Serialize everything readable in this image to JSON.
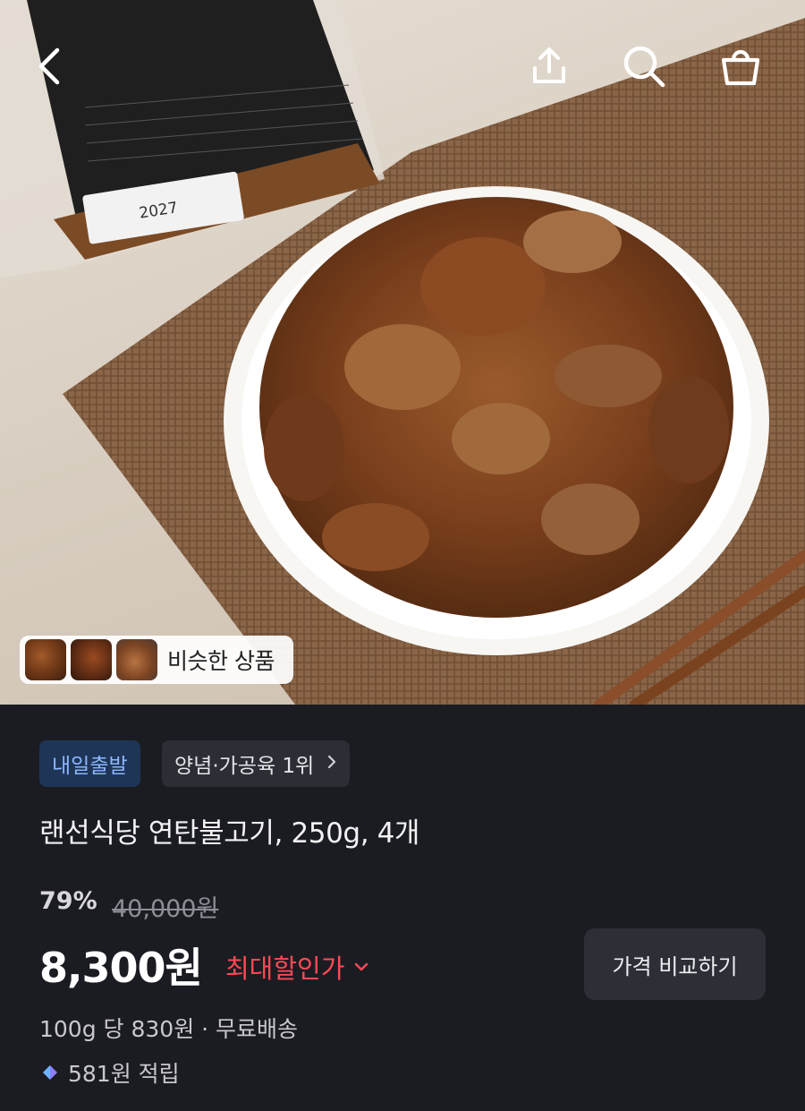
{
  "hero": {
    "image": "bulgogi-plate-photo",
    "package_date_text": "2027",
    "similar_products": {
      "label": "비슷한 상품",
      "thumbnails": [
        "thumb-1",
        "thumb-2",
        "thumb-3"
      ]
    }
  },
  "header": {
    "icons": [
      "back-icon",
      "share-icon",
      "search-icon",
      "cart-icon"
    ]
  },
  "product": {
    "badges": {
      "delivery": "내일출발",
      "ranking": "양념·가공육 1위"
    },
    "title": "랜선식당 연탄불고기, 250g, 4개",
    "discount_rate": "79%",
    "original_price": "40,000원",
    "sale_price": "8,300원",
    "max_discount_label": "최대할인가",
    "compare_button": "가격 비교하기",
    "unit_price_line": "100g 당 830원 · 무료배송",
    "points_line": "581원 적립"
  },
  "colors": {
    "panel_bg": "#1b1c22",
    "delivery_badge_bg": "#1e3557",
    "delivery_badge_text": "#8cb6ff",
    "sale_accent": "#ff4a55",
    "button_bg": "#2d2e36"
  }
}
